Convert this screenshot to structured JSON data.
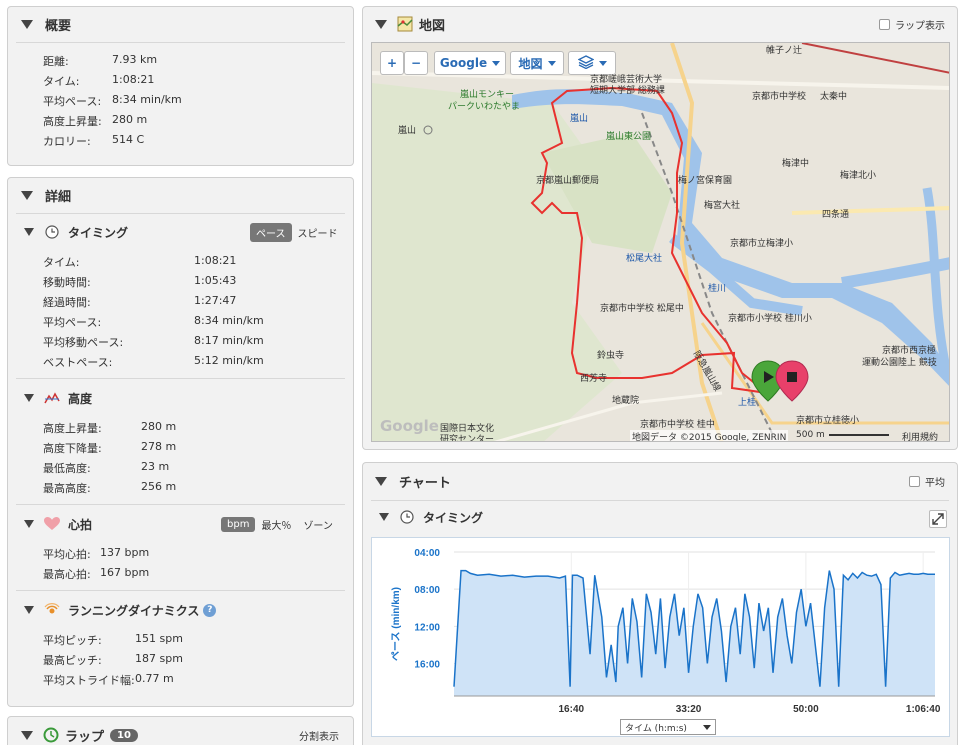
{
  "summary": {
    "title": "概要",
    "rows": [
      {
        "label": "距離:",
        "value": "7.93 km"
      },
      {
        "label": "タイム:",
        "value": "1:08:21"
      },
      {
        "label": "平均ペース:",
        "value": "8:34 min/km"
      },
      {
        "label": "高度上昇量:",
        "value": "280 m"
      },
      {
        "label": "カロリー:",
        "value": "514 C"
      }
    ]
  },
  "details": {
    "title": "詳細",
    "timing": {
      "title": "タイミング",
      "toggle": [
        "ペース",
        "スピード"
      ],
      "rows": [
        {
          "label": "タイム:",
          "value": "1:08:21"
        },
        {
          "label": "移動時間:",
          "value": "1:05:43"
        },
        {
          "label": "経過時間:",
          "value": "1:27:47"
        },
        {
          "label": "平均ペース:",
          "value": "8:34 min/km"
        },
        {
          "label": "平均移動ペース:",
          "value": "8:17 min/km"
        },
        {
          "label": "ベストペース:",
          "value": "5:12 min/km"
        }
      ]
    },
    "elevation": {
      "title": "高度",
      "rows": [
        {
          "label": "高度上昇量:",
          "value": "280 m"
        },
        {
          "label": "高度下降量:",
          "value": "278 m"
        },
        {
          "label": "最低高度:",
          "value": "23 m"
        },
        {
          "label": "最高高度:",
          "value": "256 m"
        }
      ]
    },
    "heart_rate": {
      "title": "心拍",
      "toggle": [
        "bpm",
        "最大％",
        "ゾーン"
      ],
      "rows": [
        {
          "label": "平均心拍:",
          "value": "137 bpm"
        },
        {
          "label": "最高心拍:",
          "value": "167 bpm"
        }
      ]
    },
    "running_dynamics": {
      "title": "ランニングダイナミクス",
      "help": "?",
      "rows": [
        {
          "label": "平均ピッチ:",
          "value": "151 spm"
        },
        {
          "label": "最高ピッチ:",
          "value": "187 spm"
        },
        {
          "label": "平均ストライド幅:",
          "value": "0.77 m"
        }
      ]
    }
  },
  "laps": {
    "title": "ラップ",
    "count": "10",
    "split_label": "分割表示"
  },
  "map_panel": {
    "title": "地図",
    "lap_display": "ラップ表示",
    "controls": {
      "zoom_in": "+",
      "zoom_out": "−",
      "google": "Google",
      "map_type": "地図"
    },
    "labels": [
      {
        "text": "京都嵯峨芸術大学",
        "cls": ""
      },
      {
        "text": "短期大学部 総務課",
        "cls": ""
      },
      {
        "text": "嵐山モンキー",
        "cls": "green"
      },
      {
        "text": "パークいわたやま",
        "cls": "green"
      },
      {
        "text": "嵐山",
        "cls": "blue"
      },
      {
        "text": "嵐山東公園",
        "cls": "green"
      },
      {
        "text": "嵐山",
        "cls": ""
      },
      {
        "text": "京都嵐山郵便局",
        "cls": ""
      },
      {
        "text": "梅ノ宮保育園",
        "cls": ""
      },
      {
        "text": "梅宮大社",
        "cls": ""
      },
      {
        "text": "京都市立梅津小",
        "cls": ""
      },
      {
        "text": "松尾大社",
        "cls": "blue"
      },
      {
        "text": "桂川",
        "cls": "blue"
      },
      {
        "text": "京都市中学校",
        "cls": ""
      },
      {
        "text": "太秦中",
        "cls": ""
      },
      {
        "text": "梅津中",
        "cls": ""
      },
      {
        "text": "梅津北小",
        "cls": ""
      },
      {
        "text": "四条通",
        "cls": ""
      },
      {
        "text": "京都市中学校 松尾中",
        "cls": ""
      },
      {
        "text": "京都市小学校 桂川小",
        "cls": ""
      },
      {
        "text": "鈴虫寺",
        "cls": ""
      },
      {
        "text": "西芳寺",
        "cls": ""
      },
      {
        "text": "地蔵院",
        "cls": ""
      },
      {
        "text": "京都市中学校 桂中",
        "cls": ""
      },
      {
        "text": "京都市立桂徳小",
        "cls": ""
      },
      {
        "text": "上桂",
        "cls": "blue"
      },
      {
        "text": "阪急嵐山線",
        "cls": ""
      },
      {
        "text": "京都市西京極",
        "cls": ""
      },
      {
        "text": "運動公園陸上 競技",
        "cls": ""
      },
      {
        "text": "国際日本文化",
        "cls": ""
      },
      {
        "text": "研究センター",
        "cls": ""
      },
      {
        "text": "帷子ノ辻",
        "cls": ""
      },
      {
        "text": "Google",
        "cls": ""
      }
    ],
    "footer": {
      "data": "地図データ ©2015 Google, ZENRIN",
      "scale": "500 m",
      "terms": "利用規約"
    }
  },
  "chart_panel": {
    "title": "チャート",
    "average_label": "平均",
    "sub_title": "タイミング",
    "axis_select": "タイム (h:m:s)"
  },
  "chart_data": {
    "type": "area",
    "ylabel": "ペース (min/km)",
    "xlabel": "タイム (h:m:s)",
    "y_ticks": [
      "04:00",
      "08:00",
      "12:00",
      "16:00"
    ],
    "x_ticks": [
      "16:40",
      "33:20",
      "50:00",
      "1:06:40"
    ],
    "y_range_min_per_km": [
      4,
      19.5
    ],
    "x_range_seconds": [
      0,
      4101
    ],
    "y_inverted": true,
    "grid": true,
    "series_color": "#1a73c9",
    "fill_color": "#cfe3f7",
    "series": [
      {
        "x": [
          0,
          60,
          100,
          140,
          200,
          300,
          400,
          500,
          600,
          700,
          800,
          900,
          950,
          990,
          1010,
          1050,
          1100,
          1160,
          1200,
          1260,
          1300,
          1340,
          1380,
          1400,
          1440,
          1480,
          1520,
          1560,
          1600,
          1640,
          1680,
          1720,
          1760,
          1800,
          1840,
          1880,
          1920,
          1960,
          2000,
          2040,
          2080,
          2120,
          2160,
          2200,
          2240,
          2280,
          2320,
          2360,
          2400,
          2440,
          2480,
          2520,
          2560,
          2600,
          2640,
          2680,
          2720,
          2760,
          2800,
          2840,
          2880,
          2920,
          2960,
          3000,
          3040,
          3080,
          3120,
          3160,
          3200,
          3240,
          3280,
          3320,
          3360,
          3400,
          3440,
          3480,
          3520,
          3560,
          3600,
          3640,
          3680,
          3720,
          3760,
          3800,
          3840,
          3880,
          3920,
          3960,
          4000,
          4040,
          4101
        ],
        "y": [
          18.5,
          6.0,
          6.0,
          6.3,
          6.5,
          6.4,
          6.6,
          6.5,
          6.7,
          6.6,
          6.6,
          6.8,
          6.6,
          18.5,
          6.5,
          6.5,
          6.8,
          15.0,
          6.5,
          11.0,
          17.5,
          14.0,
          18.0,
          12.0,
          10.0,
          16.0,
          9.0,
          11.5,
          17.5,
          8.5,
          10.5,
          15.0,
          9.0,
          16.5,
          11.0,
          8.5,
          13.0,
          10.0,
          17.0,
          12.0,
          8.5,
          10.0,
          16.0,
          11.0,
          9.0,
          12.5,
          18.0,
          12.0,
          10.0,
          15.0,
          8.5,
          11.0,
          16.5,
          9.5,
          12.5,
          10.0,
          17.0,
          11.0,
          9.0,
          13.0,
          16.0,
          10.5,
          8.0,
          12.0,
          9.5,
          14.0,
          18.5,
          10.0,
          6.0,
          8.0,
          18.5,
          6.5,
          7.0,
          6.3,
          6.8,
          6.2,
          6.5,
          6.6,
          6.4,
          7.5,
          18.5,
          6.8,
          6.2,
          6.5,
          6.4,
          6.3,
          6.4,
          6.4,
          6.3,
          6.4,
          6.4
        ]
      }
    ]
  }
}
